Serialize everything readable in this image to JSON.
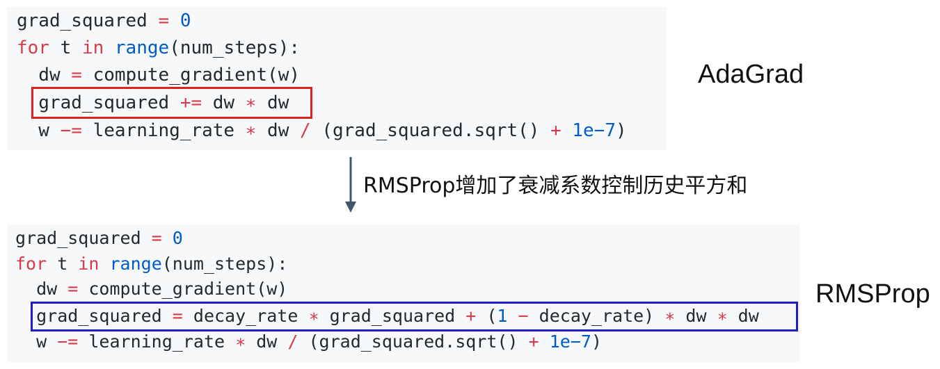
{
  "top_code": {
    "lines": [
      "grad_squared = 0",
      "for t in range(num_steps):",
      "  dw = compute_gradient(w)",
      "  grad_squared += dw * dw",
      "  w -= learning_rate * dw / (grad_squared.sqrt() + 1e-7)"
    ]
  },
  "bottom_code": {
    "lines": [
      "grad_squared = 0",
      "for t in range(num_steps):",
      "  dw = compute_gradient(w)",
      "  grad_squared = decay_rate * grad_squared + (1 - decay_rate) * dw * dw",
      "  w -= learning_rate * dw / (grad_squared.sqrt() + 1e-7)"
    ]
  },
  "labels": {
    "adagrad": "AdaGrad",
    "rmsprop": "RMSProp",
    "transition": "RMSProp增加了衰减系数控制历史平方和"
  },
  "colors": {
    "highlight_top": "#e02020",
    "highlight_bottom": "#1c1cc8",
    "keyword": "#d73a49",
    "number": "#005cc5",
    "code_background": "#f6f8fa",
    "arrow": "#44546a"
  }
}
